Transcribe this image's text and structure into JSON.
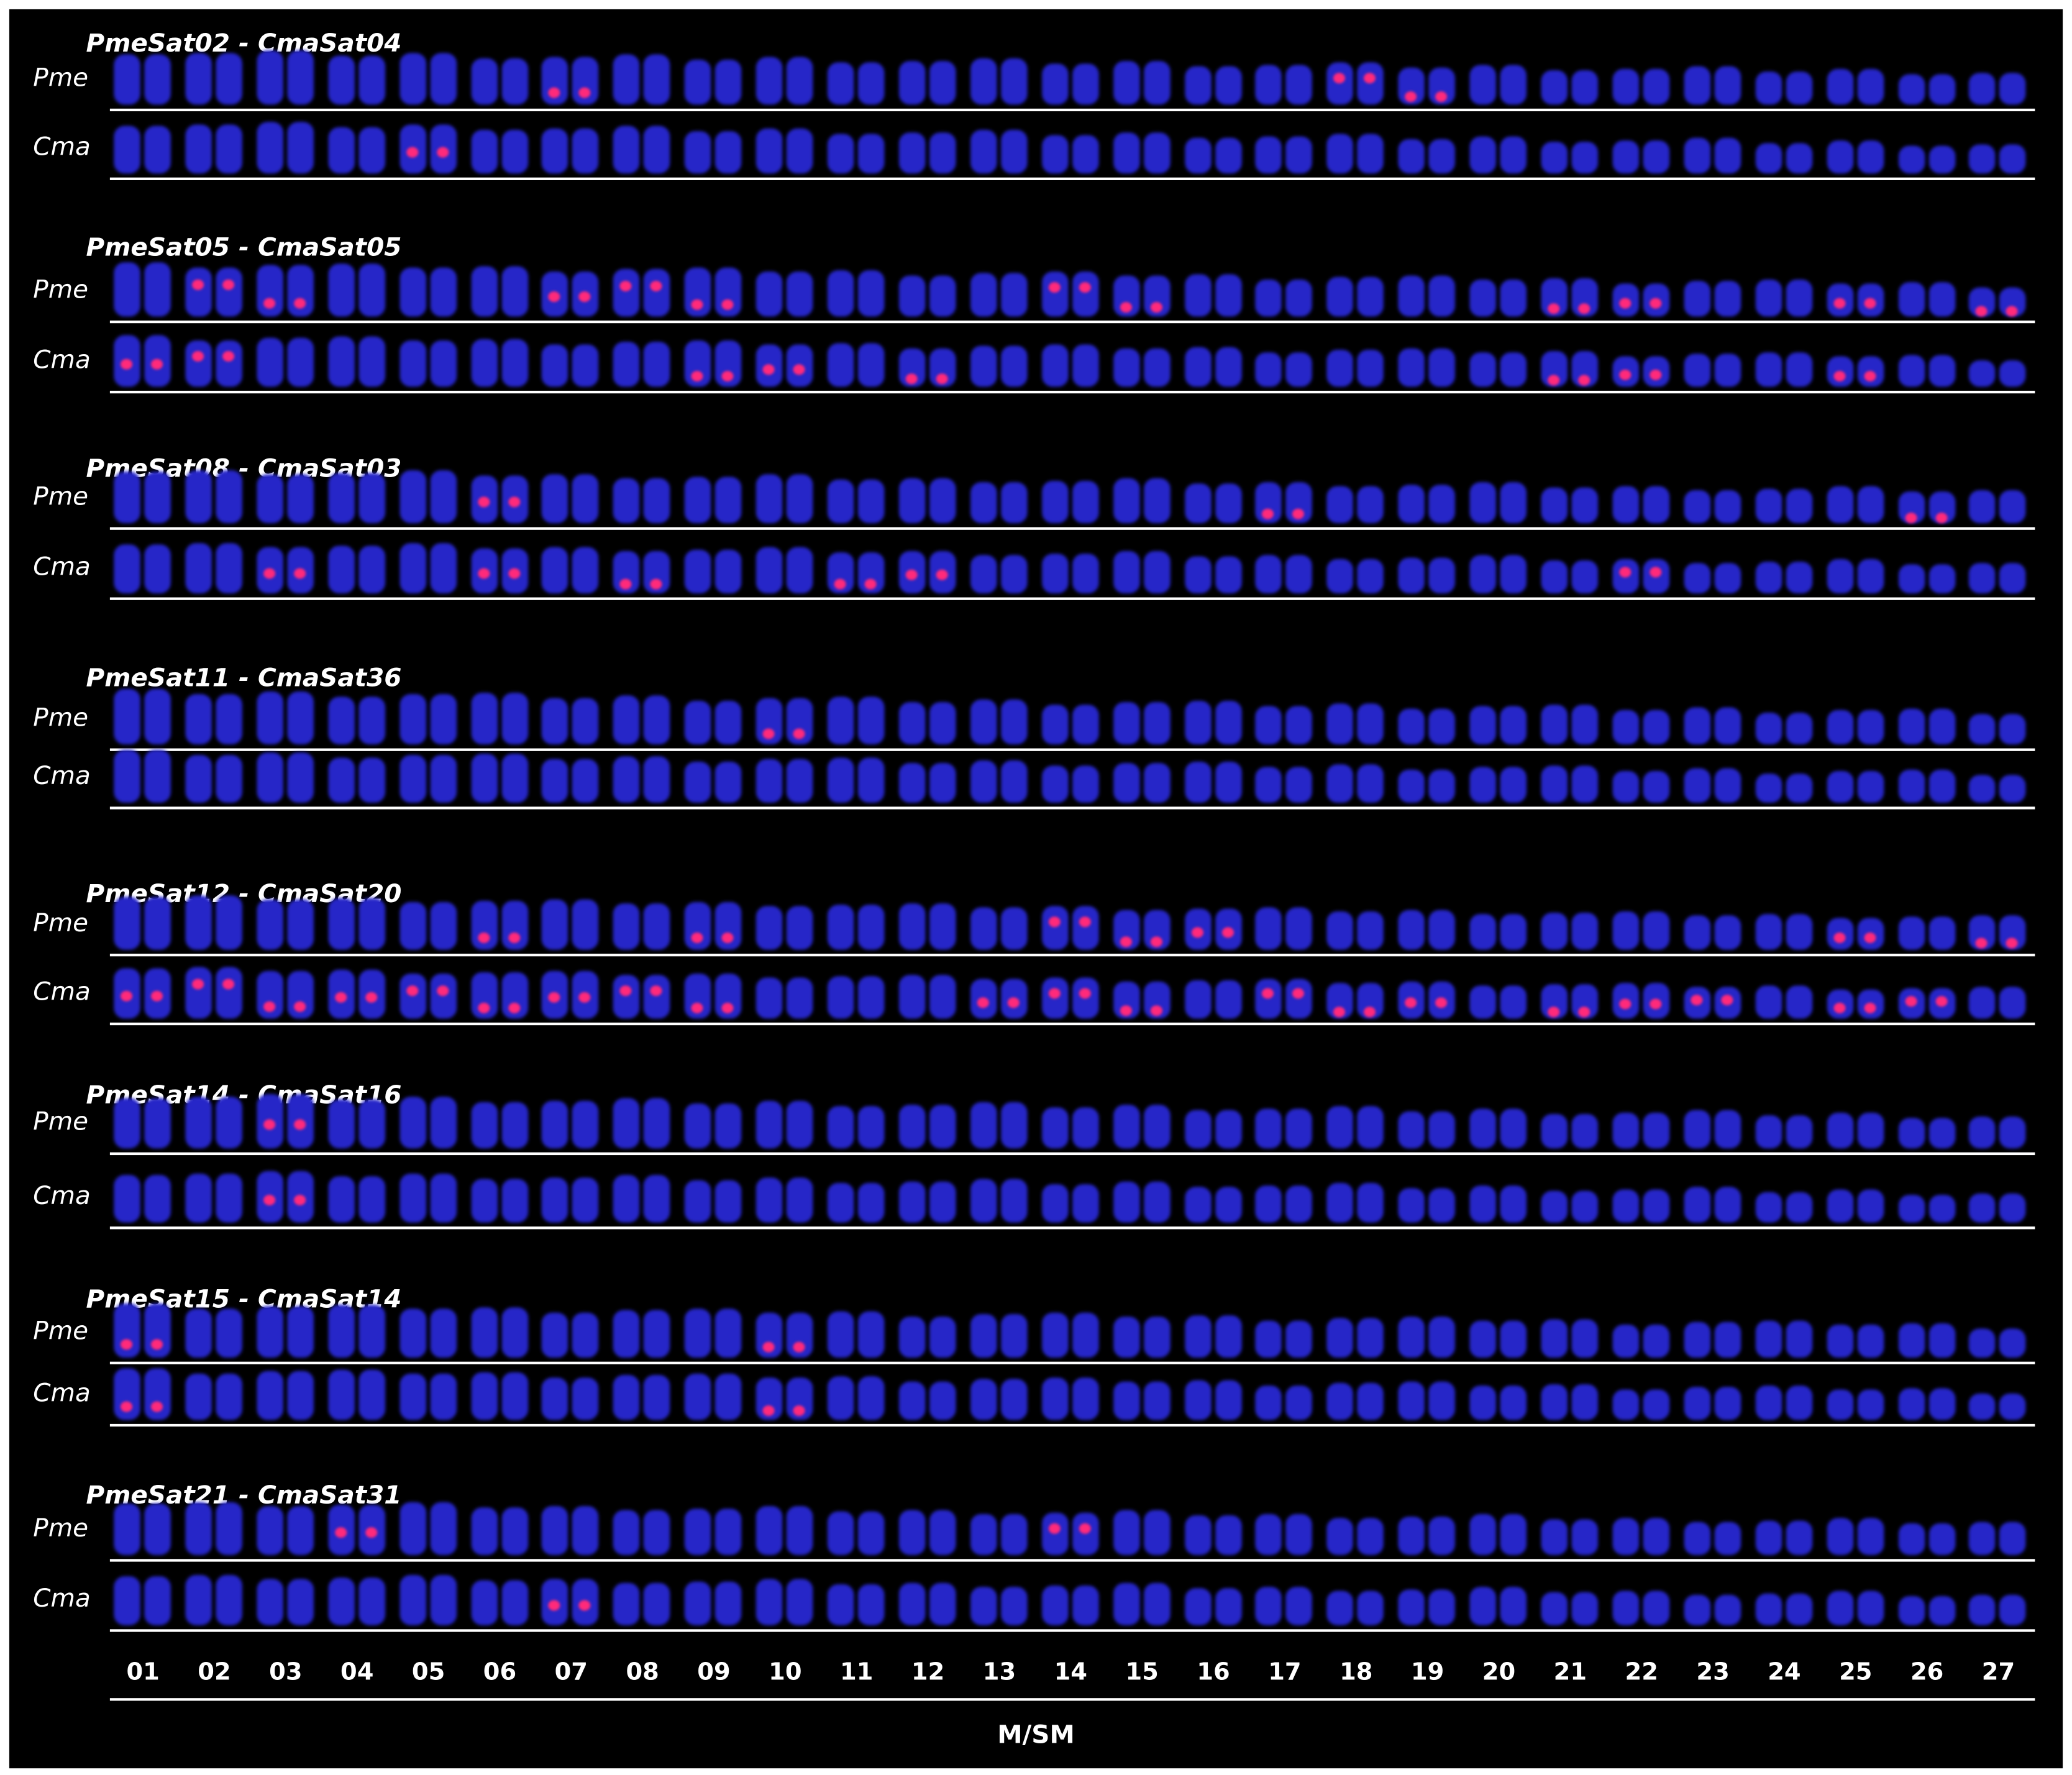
{
  "row_labels": {
    "pme": "Pme",
    "cma": "Cma"
  },
  "panels": [
    {
      "title": "PmeSat02 - CmaSat04",
      "pme_signal_pairs": [
        7,
        18,
        19
      ],
      "cma_signal_pairs": [
        5
      ]
    },
    {
      "title": "PmeSat05 - CmaSat05",
      "pme_signal_pairs": [
        2,
        3,
        7,
        8,
        9,
        14,
        15,
        21,
        22,
        25,
        27
      ],
      "cma_signal_pairs": [
        1,
        2,
        9,
        10,
        12,
        21,
        22,
        25
      ]
    },
    {
      "title": "PmeSat08 - CmaSat03",
      "pme_signal_pairs": [
        6,
        17,
        26
      ],
      "cma_signal_pairs": [
        3,
        6,
        8,
        11,
        12,
        22
      ]
    },
    {
      "title": "PmeSat11 - CmaSat36",
      "pme_signal_pairs": [
        10
      ],
      "cma_signal_pairs": []
    },
    {
      "title": "PmeSat12 - CmaSat20",
      "pme_signal_pairs": [
        6,
        9,
        14,
        15,
        16,
        25,
        27
      ],
      "cma_signal_pairs": [
        1,
        2,
        3,
        4,
        5,
        6,
        7,
        8,
        9,
        13,
        14,
        15,
        17,
        18,
        19,
        21,
        22,
        23,
        25,
        26
      ]
    },
    {
      "title": "PmeSat14 - CmaSat16",
      "pme_signal_pairs": [
        3
      ],
      "cma_signal_pairs": [
        3
      ]
    },
    {
      "title": "PmeSat15 - CmaSat14",
      "pme_signal_pairs": [
        1,
        10
      ],
      "cma_signal_pairs": [
        1,
        10
      ]
    },
    {
      "title": "PmeSat21 - CmaSat31",
      "pme_signal_pairs": [
        4,
        14
      ],
      "cma_signal_pairs": [
        7
      ]
    }
  ],
  "chromosome_numbers": [
    "01",
    "02",
    "03",
    "04",
    "05",
    "06",
    "07",
    "08",
    "09",
    "10",
    "11",
    "12",
    "13",
    "14",
    "15",
    "16",
    "17",
    "18",
    "19",
    "20",
    "21",
    "22",
    "23",
    "24",
    "25",
    "26",
    "27"
  ],
  "axis_label": "M/SM",
  "colors": {
    "dapi": "#2626c8",
    "signal": "#ff2a7a",
    "background": "#000000"
  }
}
